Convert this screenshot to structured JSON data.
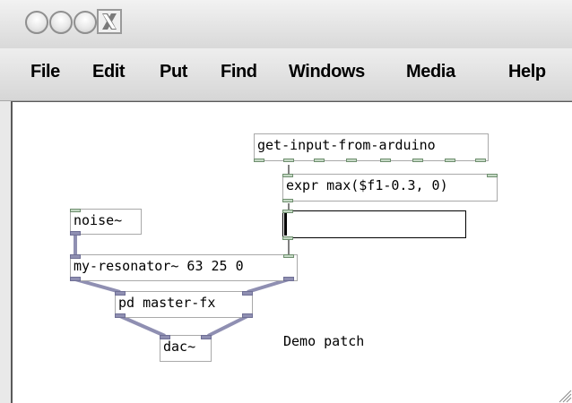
{
  "window": {
    "titlebar_buttons": [
      "close",
      "minimize",
      "zoom",
      "x11-icon"
    ]
  },
  "menubar": {
    "items": [
      {
        "label": "File"
      },
      {
        "label": "Edit"
      },
      {
        "label": "Put"
      },
      {
        "label": "Find"
      },
      {
        "label": "Windows"
      },
      {
        "label": "Media"
      },
      {
        "label": "Help"
      }
    ]
  },
  "patch": {
    "objects": {
      "get_input": "get-input-from-arduino",
      "expr": "expr max($f1-0.3, 0)",
      "noise": "noise~",
      "resonator": "my-resonator~ 63 25 0",
      "master_fx": "pd master-fx",
      "dac": "dac~"
    },
    "hslider": {
      "value": 0
    },
    "comment": "Demo patch"
  },
  "colors": {
    "signal_wire": "#8f8fb2",
    "control_wire": "#000000",
    "inlet_fill": "#c5d9c5",
    "box_border": "#a9a9a9"
  }
}
